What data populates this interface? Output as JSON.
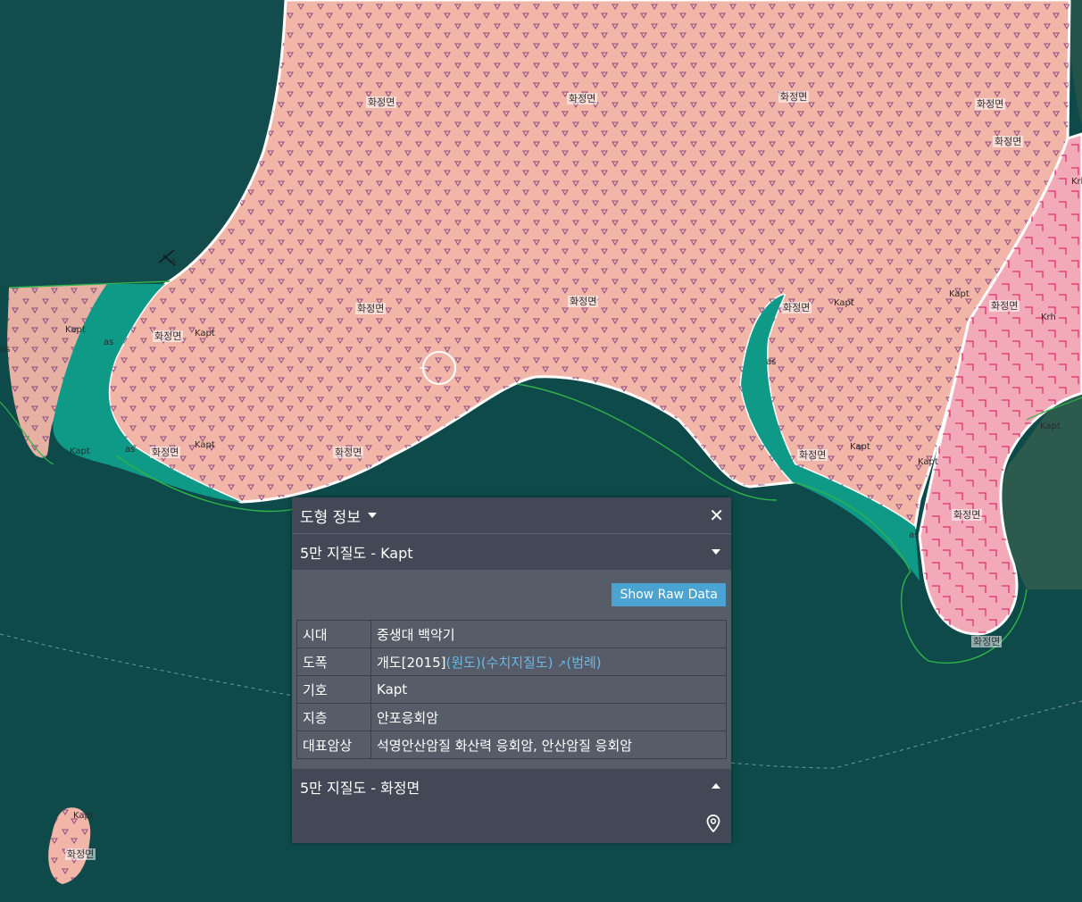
{
  "map": {
    "labels": [
      {
        "text": "화정면",
        "kind": "area"
      },
      {
        "text": "화정면",
        "kind": "area"
      },
      {
        "text": "화정면",
        "kind": "area"
      },
      {
        "text": "화정면",
        "kind": "area"
      },
      {
        "text": "화정면",
        "kind": "area"
      },
      {
        "text": "화정면",
        "kind": "area"
      },
      {
        "text": "화정면",
        "kind": "area"
      },
      {
        "text": "화정면",
        "kind": "area"
      },
      {
        "text": "화정면",
        "kind": "area"
      },
      {
        "text": "화정면",
        "kind": "area"
      },
      {
        "text": "화정면",
        "kind": "area"
      },
      {
        "text": "화정면",
        "kind": "area"
      },
      {
        "text": "화정면",
        "kind": "area"
      },
      {
        "text": "화정면",
        "kind": "area"
      },
      {
        "text": "화정면",
        "kind": "area"
      },
      {
        "text": "화정면",
        "kind": "area"
      }
    ],
    "symbols": [
      "Kapt",
      "Kapt",
      "Kapt",
      "Kapt",
      "Kapt",
      "Kapt",
      "Kapt",
      "Kapt",
      "Kapt",
      "Kapt",
      "Krh",
      "Krh",
      "as",
      "as",
      "as",
      "as",
      "as",
      "s"
    ],
    "colors": {
      "sea": "#0f4a4a",
      "kapt_fill": "#f2b6a8",
      "krh_fill": "#f3aab8",
      "as_fill": "#0e9a86",
      "boundary": "#ffffff",
      "coastline": "#2fb34a",
      "kapt_pattern": "#7a3a7a",
      "krh_pattern": "#e0306a"
    }
  },
  "panel": {
    "title": "도형 정보",
    "section1_title": "5만 지질도 - Kapt",
    "raw_button": "Show Raw Data",
    "rows": [
      {
        "key": "시대",
        "value": "중생대 백악기"
      },
      {
        "key": "도폭",
        "value": "개도[2015]",
        "links": [
          "(원도)",
          "(수치지질도)",
          "↗",
          "(범례)"
        ]
      },
      {
        "key": "기호",
        "value": "Kapt"
      },
      {
        "key": "지층",
        "value": "안포응회암"
      },
      {
        "key": "대표암상",
        "value": "석영안산암질 화산력 응회암, 안산암질 응회암"
      }
    ],
    "section2_title": "5만 지질도 - 화정면"
  }
}
